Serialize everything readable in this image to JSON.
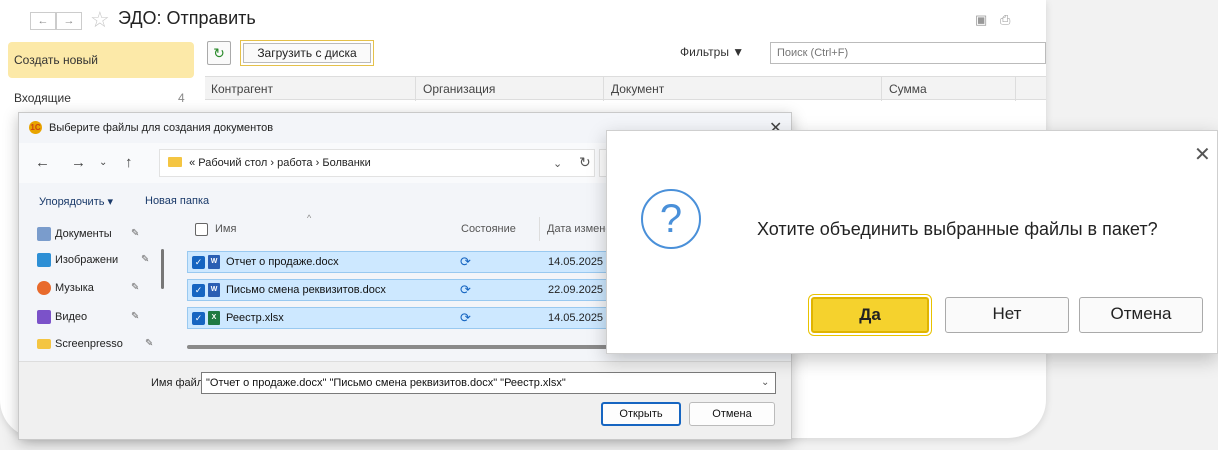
{
  "main_window": {
    "title": "ЭДО: Отправить",
    "left_panel": {
      "create_new": "Создать новый",
      "items": [
        {
          "label": "Входящие",
          "count": "4"
        }
      ]
    },
    "toolbar": {
      "load_from_disk": "Загрузить с диска",
      "filters": "Фильтры ▼",
      "search_placeholder": "Поиск (Ctrl+F)"
    },
    "table": {
      "columns": [
        "Контрагент",
        "Организация",
        "Документ",
        "Сумма"
      ]
    }
  },
  "file_dialog": {
    "title": "Выберите файлы для создания документов",
    "path": [
      "Рабочий стол",
      "работа",
      "Болванки"
    ],
    "path_prefix": "«",
    "commands": {
      "organize": "Упорядочить",
      "new_folder": "Новая папка"
    },
    "nav_items": [
      "Документы",
      "Изображени",
      "Музыка",
      "Видео",
      "Screenpresso"
    ],
    "columns": {
      "name": "Имя",
      "state": "Состояние",
      "date": "Дата измене"
    },
    "files": [
      {
        "name": "Отчет о продаже.docx",
        "date": "14.05.2025",
        "type": "docx"
      },
      {
        "name": "Письмо смена реквизитов.docx",
        "date": "22.09.2025",
        "type": "docx"
      },
      {
        "name": "Реестр.xlsx",
        "date": "14.05.2025",
        "type": "xlsx"
      }
    ],
    "filename_label": "Имя файла:",
    "filename_value": "\"Отчет о продаже.docx\" \"Письмо смена реквизитов.docx\" \"Реестр.xlsx\"",
    "open_button": "Открыть",
    "cancel_button": "Отмена"
  },
  "confirm_dialog": {
    "message": "Хотите объединить выбранные файлы в пакет?",
    "yes": "Да",
    "no": "Нет",
    "cancel": "Отмена"
  },
  "colors": {
    "accent_yellow": "#f5d22d",
    "selection_blue": "#cde8ff",
    "question_icon": "#4a90d9"
  }
}
